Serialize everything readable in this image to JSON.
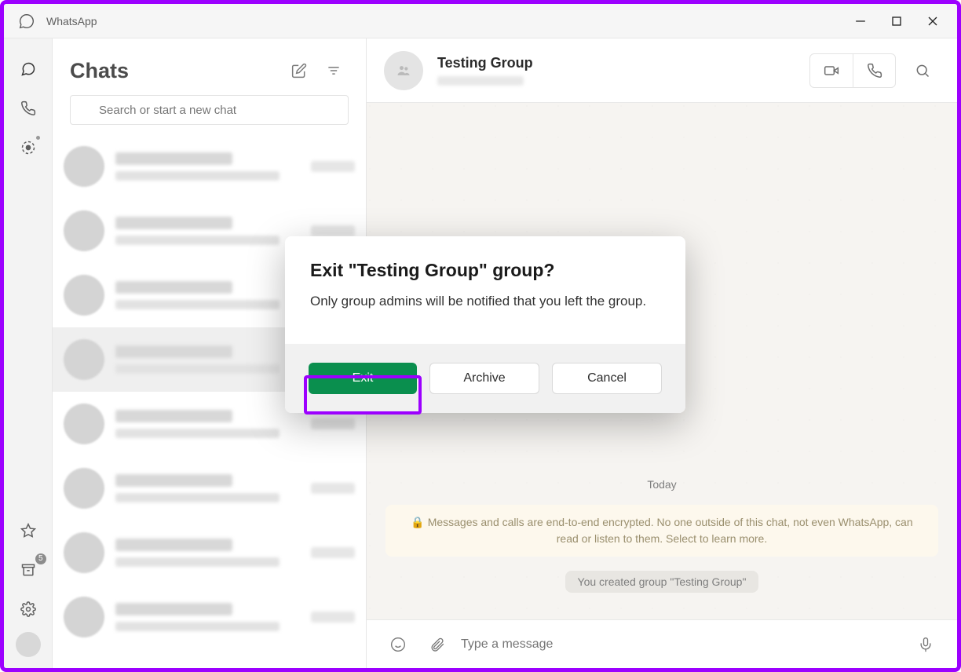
{
  "titlebar": {
    "app_title": "WhatsApp"
  },
  "chats_panel": {
    "title": "Chats",
    "search_placeholder": "Search or start a new chat"
  },
  "left_rail": {
    "archive_badge": "5"
  },
  "conversation": {
    "title": "Testing Group",
    "date_chip": "Today",
    "encryption_notice": "🔒 Messages and calls are end-to-end encrypted. No one outside of this chat, not even WhatsApp, can read or listen to them. Select to learn more.",
    "system_msg": "You created group \"Testing Group\"",
    "composer_placeholder": "Type a message"
  },
  "modal": {
    "title": "Exit \"Testing Group\" group?",
    "body": "Only group admins will be notified that you left the group.",
    "exit_label": "Exit",
    "archive_label": "Archive",
    "cancel_label": "Cancel"
  }
}
